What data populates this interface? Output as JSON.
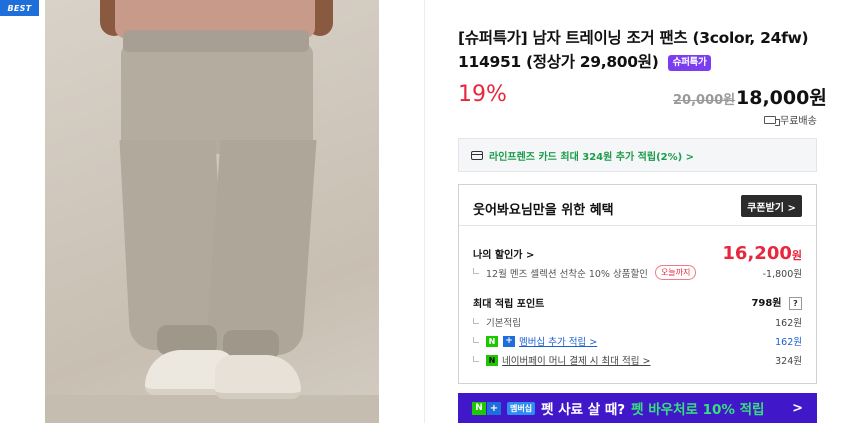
{
  "badge": "BEST",
  "product": {
    "title": "[슈퍼특가] 남자 트레이닝 조거 팬츠 (3color, 24fw) 114951 (정상가 29,800원)",
    "super_badge": "슈퍼특가",
    "discount_rate": "19%",
    "original_price": "20,000원",
    "sale_price": "18,000원",
    "shipping": "무료배송"
  },
  "card_promo": "라인프렌즈 카드 최대 324원 추가 적립(2%) >",
  "benefits": {
    "heading": "웃어봐요님만을 위한 혜택",
    "coupon_button": "쿠폰받기 >",
    "my_price_label": "나의 할인가 >",
    "my_price_value": "16,200",
    "my_price_unit": "원",
    "discount_note": "12월 멘즈 셀렉션 선착순 10% 상품할인",
    "today_badge": "오늘까지",
    "discount_amount": "-1,800원",
    "points_label": "최대 적립 포인트",
    "points_value": "798원",
    "points_help": "?",
    "basic_label": "기본적립",
    "basic_value": "162원",
    "membership_label": "멤버십 추가 적립 >",
    "membership_value": "162원",
    "npay_label": "네이버페이 머니 결제 시 최대 적립 >",
    "npay_value": "324원"
  },
  "banner": {
    "member_tag": "멤버십",
    "text_white": "펫 사료 살 때?",
    "text_green": "펫 바우처로 10% 적립",
    "arrow": ">"
  },
  "icons": {
    "n_logo": "N",
    "plus_logo": "+",
    "npay_logo": "N"
  },
  "colors": {
    "discount_red": "#e8263d",
    "super_purple": "#7a3df0",
    "banner_bg": "#4018c9",
    "naver_green": "#1ec800",
    "best_blue": "#1e6fd9"
  }
}
